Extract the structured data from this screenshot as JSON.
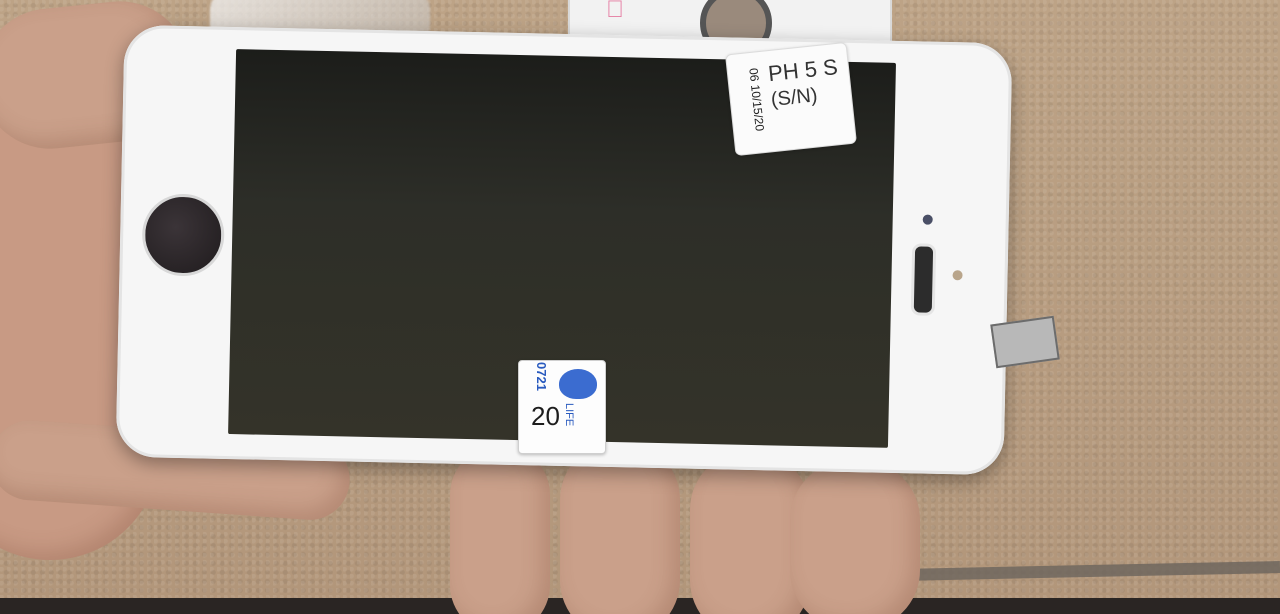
{
  "photo_subject": "",
  "labels": {
    "top_sticker": {
      "model": "PH 5 S",
      "sub": "(S/N)",
      "date": "06  10/15/20"
    },
    "blue_sticker": {
      "code": "0721",
      "number": "20",
      "brand": "LIFE"
    }
  },
  "colors": {
    "phone_frame": "#f6f6f6",
    "screen": "#2b2b28",
    "carpet": "#b79c80",
    "sticker_accent": "#2a5bbf"
  }
}
